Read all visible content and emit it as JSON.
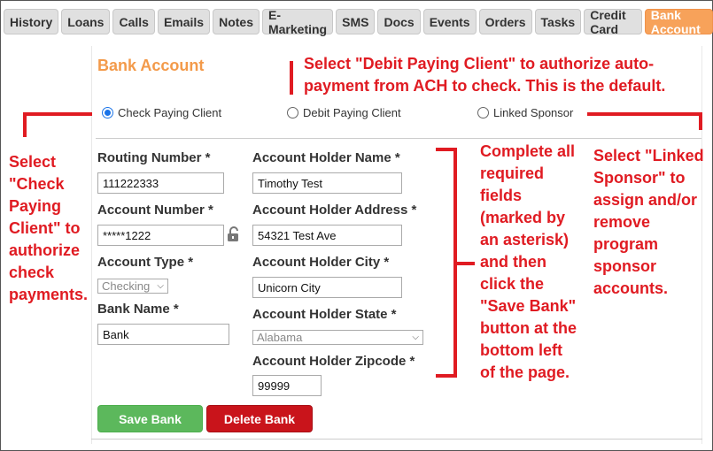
{
  "tabs": [
    {
      "label": "History"
    },
    {
      "label": "Loans"
    },
    {
      "label": "Calls"
    },
    {
      "label": "Emails"
    },
    {
      "label": "Notes"
    },
    {
      "label": "E-Marketing"
    },
    {
      "label": "SMS"
    },
    {
      "label": "Docs"
    },
    {
      "label": "Events"
    },
    {
      "label": "Orders"
    },
    {
      "label": "Tasks"
    },
    {
      "label": "Credit Card"
    },
    {
      "label": "Bank Account"
    }
  ],
  "active_tab": "Bank Account",
  "section_title": "Bank Account",
  "payment_options": {
    "check": "Check Paying Client",
    "debit": "Debit Paying Client",
    "sponsor": "Linked Sponsor",
    "selected": "Check Paying Client"
  },
  "form": {
    "routing_number": {
      "label": "Routing Number *",
      "value": "111222333"
    },
    "account_number": {
      "label": "Account Number *",
      "value": "*****1222"
    },
    "account_type": {
      "label": "Account Type *",
      "value": "Checking"
    },
    "bank_name": {
      "label": "Bank Name *",
      "value": "Bank"
    },
    "holder_name": {
      "label": "Account Holder Name *",
      "value": "Timothy Test"
    },
    "holder_address": {
      "label": "Account Holder Address *",
      "value": "54321 Test Ave"
    },
    "holder_city": {
      "label": "Account Holder City *",
      "value": "Unicorn City"
    },
    "holder_state": {
      "label": "Account Holder State *",
      "value": "Alabama"
    },
    "holder_zipcode": {
      "label": "Account Holder Zipcode *",
      "value": "99999"
    }
  },
  "buttons": {
    "save": "Save Bank",
    "delete": "Delete Bank"
  },
  "annotations": {
    "debit": [
      "Select \"Debit Paying Client\" to authorize auto-",
      "payment from ACH to check. This is  the default."
    ],
    "check": [
      "Select",
      "\"Check",
      "Paying",
      "Client\" to",
      "authorize",
      "check",
      "payments."
    ],
    "required": [
      "Complete all",
      "required",
      "fields",
      "(marked by",
      "an asterisk)",
      "and then",
      "click the",
      "\"Save Bank\"",
      "button at the",
      "bottom left",
      "of the page."
    ],
    "sponsor": [
      "Select \"Linked",
      "Sponsor\" to",
      "assign and/or",
      "remove",
      "program",
      "sponsor",
      "accounts."
    ]
  },
  "colors": {
    "accent": "#f7a25a",
    "annotation": "#e01b22",
    "save": "#5cb85c",
    "delete": "#c9141b"
  }
}
